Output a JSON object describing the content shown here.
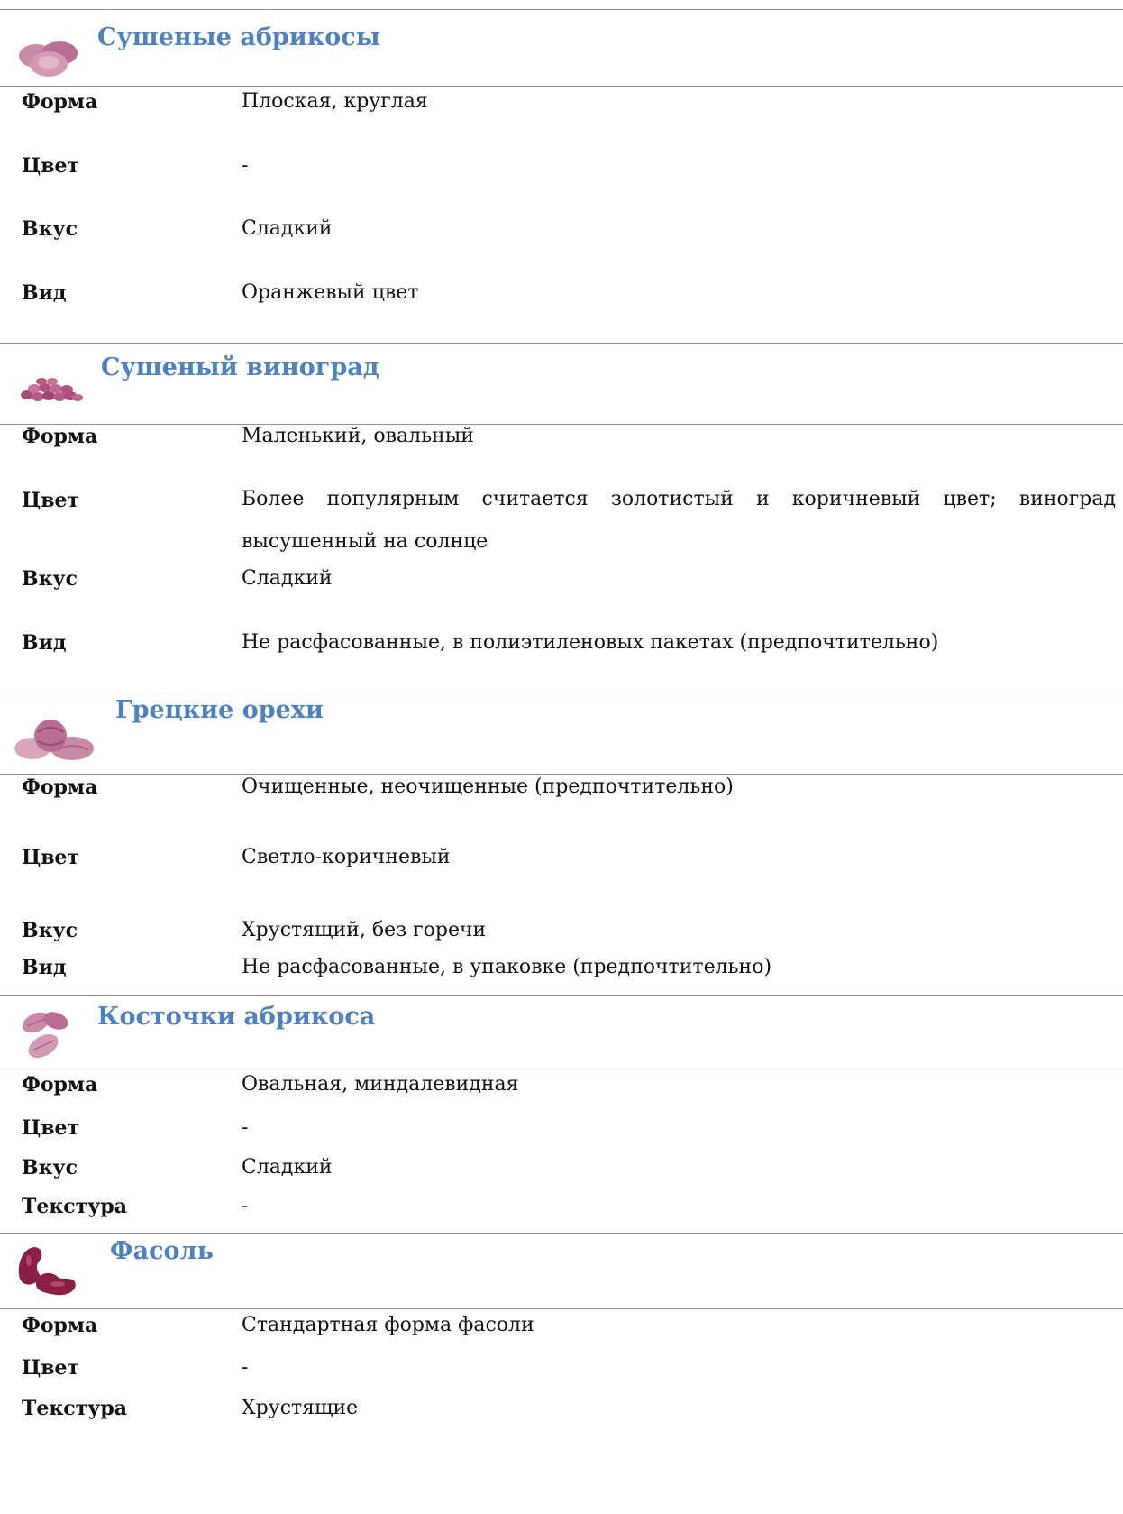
{
  "sections": [
    {
      "title": "Сушеные абрикосы",
      "icon": "dried-apricots-icon",
      "rows": [
        {
          "label": "Форма",
          "value": "Плоская, круглая"
        },
        {
          "label": "Цвет",
          "value": "-"
        },
        {
          "label": "Вкус",
          "value": "Сладкий"
        },
        {
          "label": "Вид",
          "value": "Оранжевый цвет"
        }
      ]
    },
    {
      "title": "Сушеный виноград",
      "icon": "raisins-icon",
      "rows": [
        {
          "label": "Форма",
          "value": "Маленький, овальный"
        },
        {
          "label": "Цвет",
          "value": "Более популярным считается золотистый и коричневый цвет; виноград высушенный на солнце"
        },
        {
          "label": "Вкус",
          "value": "Сладкий"
        },
        {
          "label": "Вид",
          "value": "Не расфасованные, в полиэтиленовых пакетах (предпочтительно)"
        }
      ]
    },
    {
      "title": "Грецкие орехи",
      "icon": "walnuts-icon",
      "rows": [
        {
          "label": "Форма",
          "value": "Очищенные, неочищенные (предпочтительно)"
        },
        {
          "label": "Цвет",
          "value": "Светло-коричневый"
        },
        {
          "label": "Вкус",
          "value": "Хрустящий, без горечи"
        },
        {
          "label": "Вид",
          "value": "Не расфасованные, в упаковке (предпочтительно)"
        }
      ]
    },
    {
      "title": "Косточки абрикоса",
      "icon": "apricot-kernels-icon",
      "rows": [
        {
          "label": "Форма",
          "value": "Овальная, миндалевидная"
        },
        {
          "label": "Цвет",
          "value": "-"
        },
        {
          "label": "Вкус",
          "value": "Сладкий"
        },
        {
          "label": "Текстура",
          "value": "-"
        }
      ]
    },
    {
      "title": "Фасоль",
      "icon": "beans-icon",
      "rows": [
        {
          "label": "Форма",
          "value": "Стандартная форма фасоли"
        },
        {
          "label": "Цвет",
          "value": "-"
        },
        {
          "label": "Текстура",
          "value": "Хрустящие"
        }
      ]
    }
  ],
  "colors": {
    "title": "#4f81bd",
    "rule": "#8a8a8a",
    "icon": "#b05f86",
    "bean": "#8a1f45"
  }
}
